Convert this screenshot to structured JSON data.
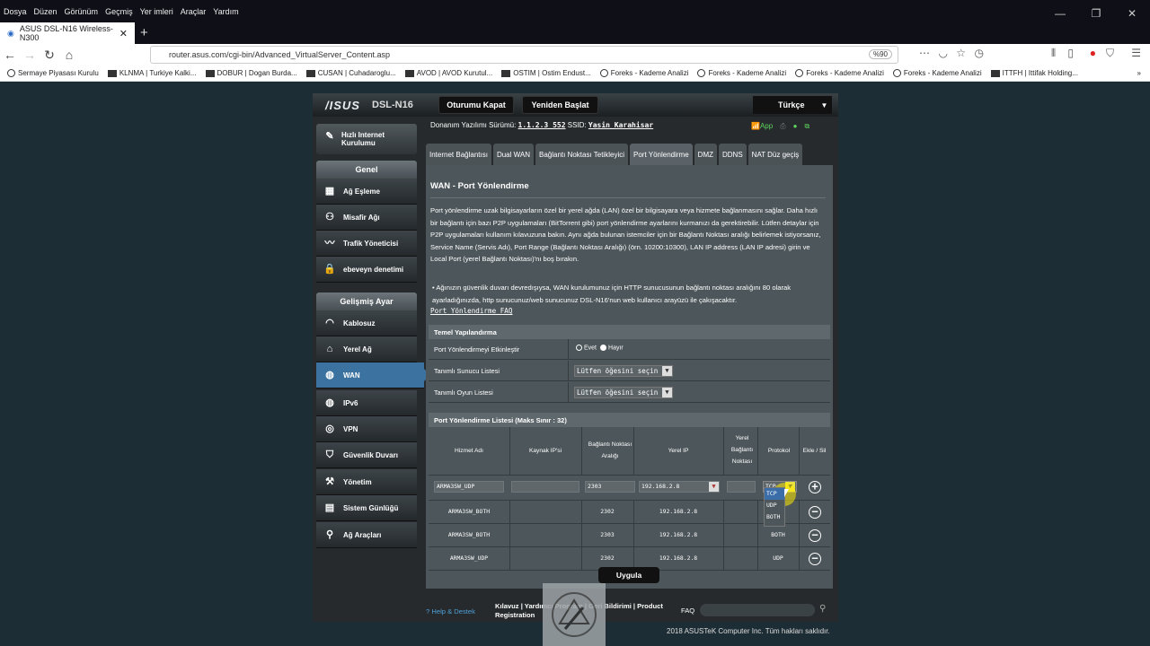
{
  "browser": {
    "menu": [
      "Dosya",
      "Düzen",
      "Görünüm",
      "Geçmiş",
      "Yer imleri",
      "Araçlar",
      "Yardım"
    ],
    "tab_title": "ASUS DSL-N16 Wireless-N300",
    "url": "router.asus.com/cgi-bin/Advanced_VirtualServer_Content.asp",
    "zoom": "%90",
    "bookmarks": [
      "Sermaye Piyasası Kurulu",
      "KLNMA | Turkiye Kalki...",
      "DOBUR | Dogan Burda...",
      "CUSAN | Cuhadaroglu...",
      "AVOD | AVOD Kurutul...",
      "OSTIM | Ostim Endust...",
      "Foreks - Kademe Analizi",
      "Foreks - Kademe Analizi",
      "Foreks - Kademe Analizi",
      "Foreks - Kademe Analizi",
      "ITTFH | Ittifak Holding..."
    ]
  },
  "router": {
    "brand": "/ISUS",
    "model": "DSL-N16",
    "logout_label": "Oturumu Kapat",
    "reboot_label": "Yeniden Başlat",
    "language": "Türkçe",
    "fw_label": "Donanım Yazılımı Sürümü:",
    "fw_version": "1.1.2.3_552",
    "ssid_label": "SSID:",
    "ssid": "Yasin_Karahisar",
    "app_label": "App",
    "qis_label": "Hızlı Internet Kurulumu",
    "sec_general": "Genel",
    "general_items": [
      "Ağ Eşleme",
      "Misafir Ağı",
      "Trafik Yöneticisi",
      "ebeveyn denetimi"
    ],
    "sec_advanced": "Gelişmiş Ayar",
    "advanced_items": [
      "Kablosuz",
      "Yerel Ağ",
      "WAN",
      "IPv6",
      "VPN",
      "Güvenlik Duvarı",
      "Yönetim",
      "Sistem Günlüğü",
      "Ağ Araçları"
    ],
    "tabs": [
      "Internet Bağlantısı",
      "Dual WAN",
      "Bağlantı Noktası Tetikleyici",
      "Port Yönlendirme",
      "DMZ",
      "DDNS",
      "NAT Düz geçiş"
    ],
    "active_tab": "Port Yönlendirme",
    "page_title": "WAN - Port Yönlendirme",
    "description": "Port yönlendirme uzak bilgisayarların özel bir yerel ağda (LAN) özel bir bilgisayara veya hizmete bağlanmasını sağlar. Daha hızlı bir bağlantı için bazı P2P uygulamaları (BitTorrent gibi) port yönlendirme ayarlarını kurmanızı da gerektirebilir. Lütfen detaylar için P2P uygulamaları kullanım kılavuzuna bakın. Aynı ağda bulunan istemciler için bir Bağlantı Noktası aralığı belirlemek istiyorsanız, Service Name (Servis Adı), Port Range (Bağlantı Noktası Aralığı) (örn. 10200:10300), LAN IP address (LAN IP adresi) girin ve Local Port (yerel Bağlantı Noktası)'nı boş bırakın.",
    "bullet": "• Ağınızın güvenlik duvarı devredışıysa, WAN kurulumunuz için HTTP sunucusunun bağlantı noktası aralığını 80 olarak ayarladığınızda, http sunucunuz/web sunucunuz DSL-N16'nun web kullanıcı arayüzü ile çakışacaktır.",
    "faq_link": "Port Yönlendirme FAQ",
    "basic": {
      "header": "Temel Yapılandırma",
      "enable_label": "Port Yönlendirmeyi Etkinleştir",
      "yes": "Evet",
      "no": "Hayır",
      "server_label": "Tanımlı Sunucu Listesi",
      "game_label": "Tanımlı Oyun Listesi",
      "select_placeholder": "Lütfen öğesini seçin"
    },
    "list": {
      "header": "Port Yönlendirme Listesi (Maks Sınır : 32)",
      "col_service": "Hizmet Adı",
      "col_source": "Kaynak IP'si",
      "col_port": "Bağlantı Noktası Aralığı",
      "col_localip": "Yerel IP",
      "col_localport": "Yerel Bağlantı Noktası",
      "col_proto": "Protokol",
      "col_add": "Ekle / Sil",
      "input_row": {
        "service": "ARMA3SW_UDP",
        "port": "2303",
        "ip": "192.168.2.8",
        "proto": "TCP"
      },
      "rows": [
        {
          "service": "ARMA3SW_BOTH",
          "port": "2302",
          "ip": "192.168.2.8",
          "proto": ""
        },
        {
          "service": "ARMA3SW_BOTH",
          "port": "2303",
          "ip": "192.168.2.8",
          "proto": "BOTH"
        },
        {
          "service": "ARMA3SW_UDP",
          "port": "2302",
          "ip": "192.168.2.8",
          "proto": "UDP"
        }
      ],
      "proto_options": [
        "TCP",
        "UDP",
        "BOTH"
      ]
    },
    "apply_label": "Uygula",
    "footer": {
      "help": "Help & Destek",
      "links": "Kılavuz | Yardımcı Program | Geri Bildirimi | Product Registration",
      "faq": "FAQ"
    },
    "copyright": "2018 ASUSTeK Computer Inc. Tüm hakları saklıdır."
  },
  "colors": {
    "accent": "#3c72a0",
    "highlight": "#e8e23a"
  }
}
